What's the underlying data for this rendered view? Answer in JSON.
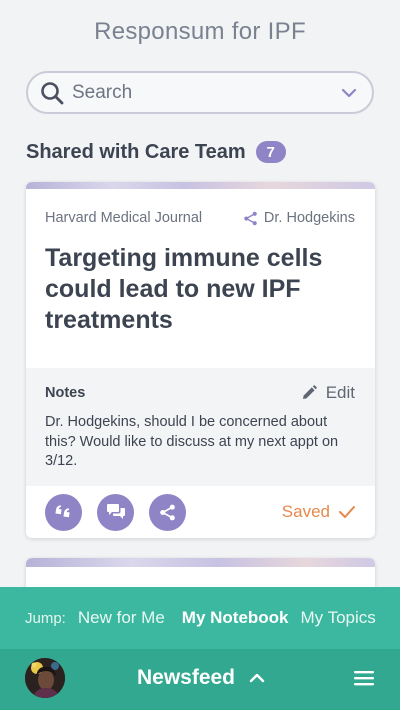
{
  "app": {
    "title": "Responsum for IPF"
  },
  "search": {
    "placeholder": "Search"
  },
  "section": {
    "title": "Shared with Care Team",
    "count": "7"
  },
  "article": {
    "source": "Harvard Medical Journal",
    "shared_by": "Dr. Hodgekins",
    "headline": "Targeting immune cells could lead to new IPF treatments",
    "notes_label": "Notes",
    "edit_label": "Edit",
    "notes_text": "Dr. Hodgekins, should I be concerned about this? Would like to discuss at my next appt on 3/12.",
    "status": "Saved"
  },
  "jump_bar": {
    "label": "Jump:",
    "items": [
      {
        "label": "New for Me"
      },
      {
        "label": "My Notebook"
      },
      {
        "label": "My Topics"
      }
    ]
  },
  "bottom_bar": {
    "title": "Newsfeed"
  },
  "colors": {
    "accent_purple": "#8e84c6",
    "saved_orange": "#e5894c",
    "jump_teal": "#3bb89f",
    "bottom_teal": "#31a88f"
  }
}
